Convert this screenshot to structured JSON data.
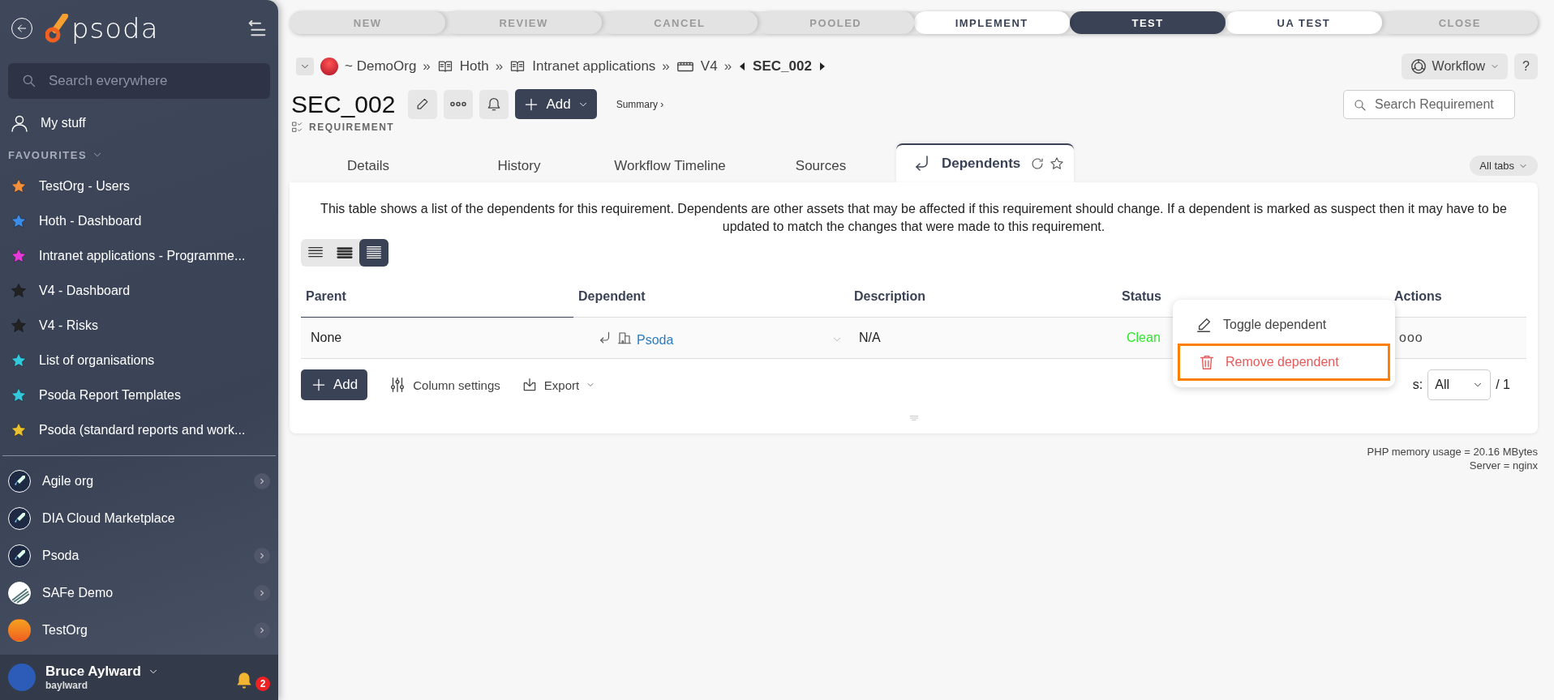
{
  "sidebar": {
    "logo": "psoda",
    "search": {
      "placeholder": "Search everywhere"
    },
    "my_stuff": "My stuff",
    "favourites_heading": "FAVOURITES",
    "favourites": [
      {
        "label": "TestOrg - Users",
        "color": "#f5913e"
      },
      {
        "label": "Hoth - Dashboard",
        "color": "#3b8de8"
      },
      {
        "label": "Intranet applications - Programme...",
        "color": "#e53ad8"
      },
      {
        "label": "V4 - Dashboard",
        "color": "#222222"
      },
      {
        "label": "V4 - Risks",
        "color": "#222222"
      },
      {
        "label": "List of organisations",
        "color": "#33c8dc"
      },
      {
        "label": "Psoda Report Templates",
        "color": "#33c8dc"
      },
      {
        "label": "Psoda (standard reports and work...",
        "color": "#e8c030"
      }
    ],
    "organisations": [
      {
        "label": "Agile org",
        "kind": "rocket",
        "has_submenu": true
      },
      {
        "label": "DIA Cloud Marketplace",
        "kind": "rocket",
        "has_submenu": false
      },
      {
        "label": "Psoda",
        "kind": "rocket",
        "has_submenu": true
      },
      {
        "label": "SAFe Demo",
        "kind": "stripes",
        "has_submenu": true
      },
      {
        "label": "TestOrg",
        "kind": "sun",
        "has_submenu": true
      }
    ],
    "user": {
      "name": "Bruce Aylward",
      "login": "baylward",
      "notifications": "2"
    }
  },
  "stages": [
    {
      "label": "NEW",
      "selected": false,
      "available": false
    },
    {
      "label": "REVIEW",
      "selected": false,
      "available": false
    },
    {
      "label": "CANCEL",
      "selected": false,
      "available": false
    },
    {
      "label": "POOLED",
      "selected": false,
      "available": false
    },
    {
      "label": "IMPLEMENT",
      "selected": false,
      "available": true
    },
    {
      "label": "TEST",
      "selected": true,
      "available": true
    },
    {
      "label": "UA TEST",
      "selected": false,
      "available": true
    },
    {
      "label": "CLOSE",
      "selected": false,
      "available": false
    }
  ],
  "breadcrumbs": [
    {
      "label": "~ DemoOrg",
      "kind": "org"
    },
    {
      "label": "Hoth",
      "kind": "book"
    },
    {
      "label": "Intranet applications",
      "kind": "book"
    },
    {
      "label": "V4",
      "kind": "board"
    }
  ],
  "breadcrumb_separator": "»",
  "current_item": "SEC_002",
  "workflow_button": "Workflow",
  "help_button": "?",
  "title": "SEC_002",
  "add_button": "Add",
  "summary_link": "Summary ›",
  "item_type": "REQUIREMENT",
  "search_requirements": {
    "placeholder": "Search Requirement"
  },
  "tabs": [
    {
      "label": "Details",
      "selected": false
    },
    {
      "label": "History",
      "selected": false
    },
    {
      "label": "Workflow Timeline",
      "selected": false
    },
    {
      "label": "Sources",
      "selected": false
    },
    {
      "label": "Dependents",
      "selected": true
    }
  ],
  "all_tabs_button": "All tabs",
  "panel": {
    "description": "This table shows a list of the dependents for this requirement. Dependents are other assets that may be affected if this requirement should change. If a dependent is marked as suspect then it may have to be updated to match the changes that were made to this requirement.",
    "density_options": [
      {
        "selected": false
      },
      {
        "selected": false
      },
      {
        "selected": true
      }
    ],
    "table": {
      "columns": [
        "Parent",
        "Dependent",
        "Description",
        "Status",
        "Actions"
      ],
      "rows": [
        {
          "parent": "None",
          "dependent": "Psoda",
          "description": "N/A",
          "status": "Clean",
          "actions": "ooo"
        }
      ]
    },
    "add_button": "Add",
    "column_settings": "Column settings",
    "export": "Export",
    "pager": {
      "label": "s:",
      "value": "All",
      "total": "/ 1"
    },
    "menu": [
      {
        "label": "Toggle dependent",
        "kind": "edit",
        "highlighted": false
      },
      {
        "label": "Remove dependent",
        "kind": "delete",
        "highlighted": true
      }
    ]
  },
  "footer": {
    "memory": "PHP memory usage = 20.16 MBytes",
    "server": "Server = nginx"
  }
}
